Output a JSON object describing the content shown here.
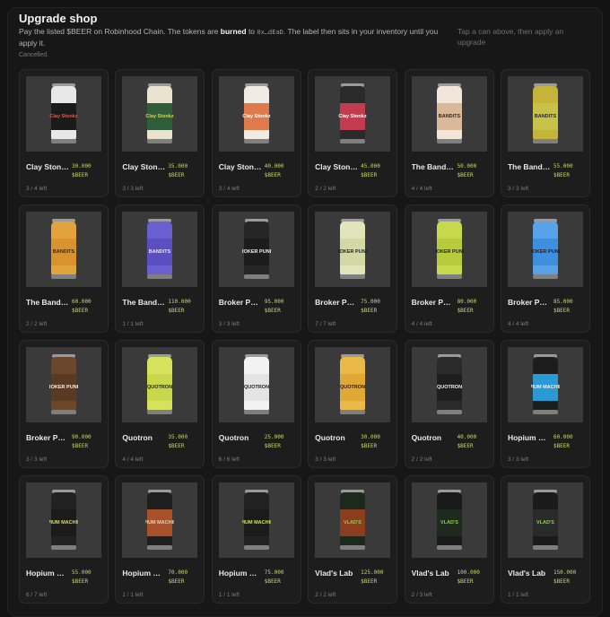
{
  "header": {
    "title": "Upgrade shop",
    "desc_1": "Pay the listed $BEER on Robinhood Chain. The tokens are ",
    "desc_bold": "burned",
    "desc_2": " to ",
    "desc_addr": "0x…dEaD",
    "desc_3": ". The label then sits in your inventory until you apply it.",
    "status": "Cancelled.",
    "hint": "Tap a can above, then apply an upgrade"
  },
  "currency": "$BEER",
  "colors": {
    "accent": "#c6d86a",
    "background": "#121212",
    "card": "#1d1d1d"
  },
  "items": [
    {
      "name": "Clay Stonkz",
      "price": "30.000",
      "stock": "3 / 4 left",
      "icon": "clay-stonkz-can-icon",
      "band": "#1a1a1a",
      "top": "#e8e8e8",
      "logo": "Clay Stonkz",
      "logo_color": "#e05a4f"
    },
    {
      "name": "Clay Stonkz",
      "price": "35.000",
      "stock": "3 / 3 left",
      "icon": "clay-stonkz-can-icon",
      "band": "#2f5d3a",
      "top": "#e9e3cf",
      "logo": "Clay Stonkz",
      "logo_color": "#d8d25a"
    },
    {
      "name": "Clay Stonkz",
      "price": "40.000",
      "stock": "3 / 4 left",
      "icon": "clay-stonkz-can-icon",
      "band": "#e07a4a",
      "top": "#f0ece4",
      "logo": "Clay Stonkz",
      "logo_color": "#ffffff"
    },
    {
      "name": "Clay Stonkz",
      "price": "45.000",
      "stock": "2 / 2 left",
      "icon": "clay-stonkz-can-icon",
      "band": "#c43a4e",
      "top": "#2a2a2a",
      "logo": "Clay Stonkz",
      "logo_color": "#ffffff"
    },
    {
      "name": "The Bandits",
      "price": "50.000",
      "stock": "4 / 4 left",
      "icon": "bandits-can-icon",
      "band": "#d9b99a",
      "top": "#f1e6da",
      "logo": "BANDITS",
      "logo_color": "#2a2a2a"
    },
    {
      "name": "The Bandits",
      "price": "55.000",
      "stock": "3 / 3 left",
      "icon": "bandits-can-icon",
      "band": "#c8c24a",
      "top": "#c6b33a",
      "logo": "BANDITS",
      "logo_color": "#2a2a2a"
    },
    {
      "name": "The Bandits",
      "price": "60.000",
      "stock": "2 / 2 left",
      "icon": "bandits-can-icon",
      "band": "#d9932e",
      "top": "#e2a23c",
      "logo": "BANDITS",
      "logo_color": "#2a2a2a"
    },
    {
      "name": "The Bandits",
      "price": "110.000",
      "stock": "1 / 1 left",
      "icon": "bandits-can-icon",
      "band": "#5a4fc0",
      "top": "#6a5fd0",
      "logo": "BANDITS",
      "logo_color": "#e8e0ff"
    },
    {
      "name": "Broker Punks",
      "price": "95.000",
      "stock": "3 / 3 left",
      "icon": "broker-punks-can-icon",
      "band": "#1c1c1c",
      "top": "#262626",
      "logo": "BROKER PUNKS",
      "logo_color": "#f0f0f0"
    },
    {
      "name": "Broker Punks",
      "price": "75.000",
      "stock": "7 / 7 left",
      "icon": "broker-punks-can-icon",
      "band": "#d4d8a4",
      "top": "#e2e5bb",
      "logo": "BROKER PUNKS",
      "logo_color": "#1f1f1f"
    },
    {
      "name": "Broker Punks",
      "price": "80.000",
      "stock": "4 / 4 left",
      "icon": "broker-punks-can-icon",
      "band": "#b7cc3a",
      "top": "#c7d84b",
      "logo": "BROKER PUNKS",
      "logo_color": "#1f1f1f"
    },
    {
      "name": "Broker Punks",
      "price": "85.000",
      "stock": "4 / 4 left",
      "icon": "broker-punks-can-icon",
      "band": "#3f8fe0",
      "top": "#58a2ea",
      "logo": "BROKER PUNKS",
      "logo_color": "#1f1f1f"
    },
    {
      "name": "Broker Punks",
      "price": "90.000",
      "stock": "3 / 3 left",
      "icon": "broker-punks-can-icon",
      "band": "#5a3a22",
      "top": "#6b482c",
      "logo": "BROKER PUNKS",
      "logo_color": "#f0f0f0"
    },
    {
      "name": "Quotron",
      "price": "35.000",
      "stock": "4 / 4 left",
      "icon": "quotron-can-icon",
      "band": "#c8d84a",
      "top": "#d6e25c",
      "logo": "QUOTRON",
      "logo_color": "#1f1f1f"
    },
    {
      "name": "Quotron",
      "price": "25.000",
      "stock": "6 / 6 left",
      "icon": "quotron-can-icon",
      "band": "#e4e4e4",
      "top": "#f2f2f2",
      "logo": "QUOTRON",
      "logo_color": "#1f1f1f"
    },
    {
      "name": "Quotron",
      "price": "30.000",
      "stock": "3 / 3 left",
      "icon": "quotron-can-icon",
      "band": "#e0a834",
      "top": "#ebb948",
      "logo": "QUOTRON",
      "logo_color": "#1f1f1f"
    },
    {
      "name": "Quotron",
      "price": "40.000",
      "stock": "2 / 2 left",
      "icon": "quotron-can-icon",
      "band": "#1e1e1e",
      "top": "#2a2a2a",
      "logo": "QUOTRON",
      "logo_color": "#f0f0f0"
    },
    {
      "name": "Hopium Machines",
      "price": "60.000",
      "stock": "3 / 3 left",
      "icon": "hopium-machines-can-icon",
      "band": "#2a9ad4",
      "top": "#1d1d1d",
      "logo": "HOPIUM MACHINES",
      "logo_color": "#f0f0f0"
    },
    {
      "name": "Hopium Machines",
      "price": "55.000",
      "stock": "6 / 7 left",
      "icon": "hopium-machines-can-icon",
      "band": "#1b1b1b",
      "top": "#222222",
      "logo": "HOPIUM MACHINES",
      "logo_color": "#d6e25c"
    },
    {
      "name": "Hopium Machines",
      "price": "70.000",
      "stock": "1 / 1 left",
      "icon": "hopium-machines-can-icon",
      "band": "#a8502a",
      "top": "#1e1e1e",
      "logo": "HOPIUM MACHINES",
      "logo_color": "#f0d0b0"
    },
    {
      "name": "Hopium Machines",
      "price": "75.000",
      "stock": "1 / 1 left",
      "icon": "hopium-machines-can-icon",
      "band": "#1b1b1b",
      "top": "#222222",
      "logo": "HOPIUM MACHINES",
      "logo_color": "#d6e25c"
    },
    {
      "name": "Vlad's Lab",
      "price": "125.000",
      "stock": "2 / 2 left",
      "icon": "vlads-can-icon",
      "band": "#8a3e1e",
      "top": "#1b2a1b",
      "logo": "VLAD'S",
      "logo_color": "#8ad04a"
    },
    {
      "name": "Vlad's Lab",
      "price": "100.000",
      "stock": "2 / 3 left",
      "icon": "vlads-can-icon",
      "band": "#1e2a1e",
      "top": "#1a1a1a",
      "logo": "VLAD'S",
      "logo_color": "#8ad04a"
    },
    {
      "name": "Vlad's Lab",
      "price": "150.000",
      "stock": "1 / 1 left",
      "icon": "vlads-can-icon",
      "band": "#2a2a2a",
      "top": "#1a1a1a",
      "logo": "VLAD'S",
      "logo_color": "#8ad04a"
    }
  ]
}
